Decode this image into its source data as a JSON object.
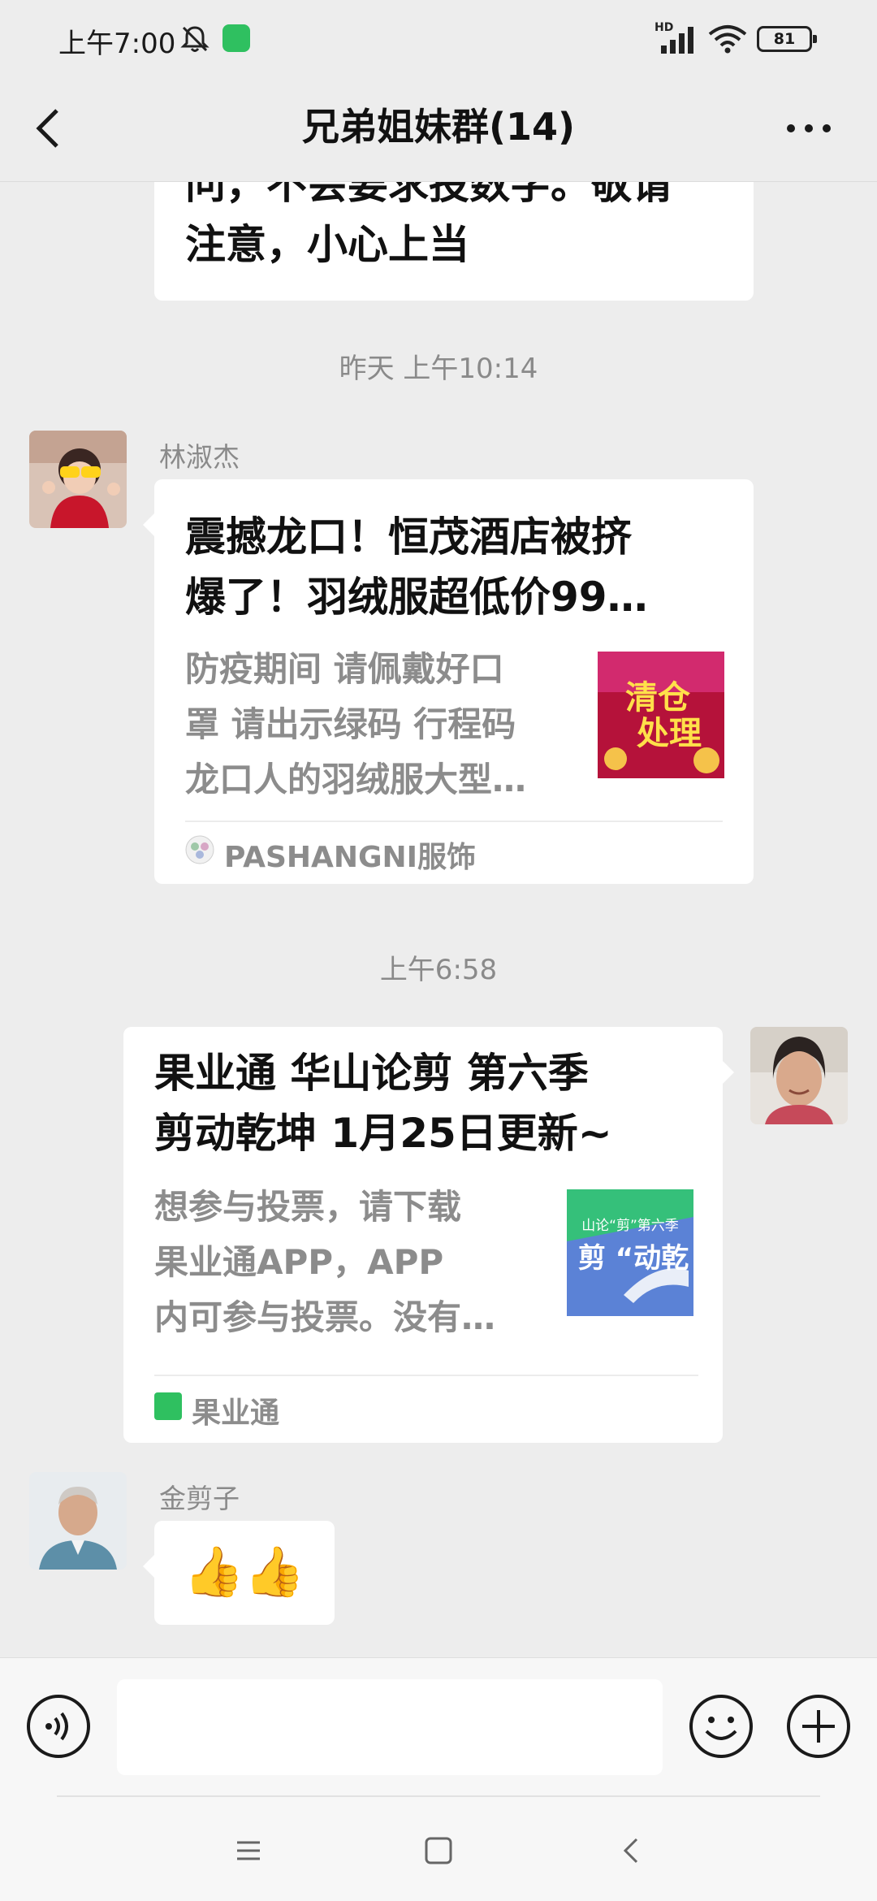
{
  "status_bar": {
    "time": "上午7:00",
    "network": "HD",
    "battery": "81",
    "icons": [
      "mute-bell-icon",
      "app-notification-icon",
      "signal-icon",
      "wifi-icon",
      "battery-icon"
    ]
  },
  "header": {
    "title": "兄弟姐妹群(14)",
    "back_icon": "chevron-left-icon",
    "more_icon": "more-dots-icon"
  },
  "messages": [
    {
      "type": "text",
      "lines": [
        "问，不会要求投数字。敬请",
        "注意，小心上当"
      ]
    },
    {
      "type": "timestamp",
      "text": "昨天 上午10:14"
    },
    {
      "type": "link_card",
      "sender": "林淑杰",
      "title": "震撼龙口！恒茂酒店被挤爆了！羽绒服超低价99…",
      "title_lines": [
        "震撼龙口！恒茂酒店被挤",
        "爆了！羽绒服超低价99…"
      ],
      "desc_lines": [
        "防疫期间 请佩戴好口",
        "罩 请出示绿码 行程码",
        "龙口人的羽绒服大型…"
      ],
      "thumb_text": [
        "清仓",
        "处理"
      ],
      "source": "PASHANGNI服饰"
    },
    {
      "type": "timestamp",
      "text": "上午6:58"
    },
    {
      "type": "link_card",
      "sender": "",
      "title_lines": [
        "果业通 华山论剪 第六季",
        "剪动乾坤 1月25日更新~"
      ],
      "desc_lines": [
        "想参与投票，请下载",
        "果业通APP，APP",
        "内可参与投票。没有…"
      ],
      "thumb_text": [
        "山论“剪”第六季",
        "剪 “动乾"
      ],
      "source": "果业通"
    },
    {
      "type": "emoji",
      "sender": "金剪子",
      "content": "👍👍"
    }
  ],
  "input": {
    "value": "",
    "placeholder": "",
    "icons": [
      "voice-icon",
      "emoji-icon",
      "plus-icon"
    ]
  },
  "nav": {
    "icons": [
      "menu-icon",
      "home-icon",
      "back-icon"
    ]
  },
  "colors": {
    "background": "#ededed",
    "bubble": "#ffffff",
    "muted_text": "#8a8a8a",
    "brand_green": "#2fc060"
  }
}
